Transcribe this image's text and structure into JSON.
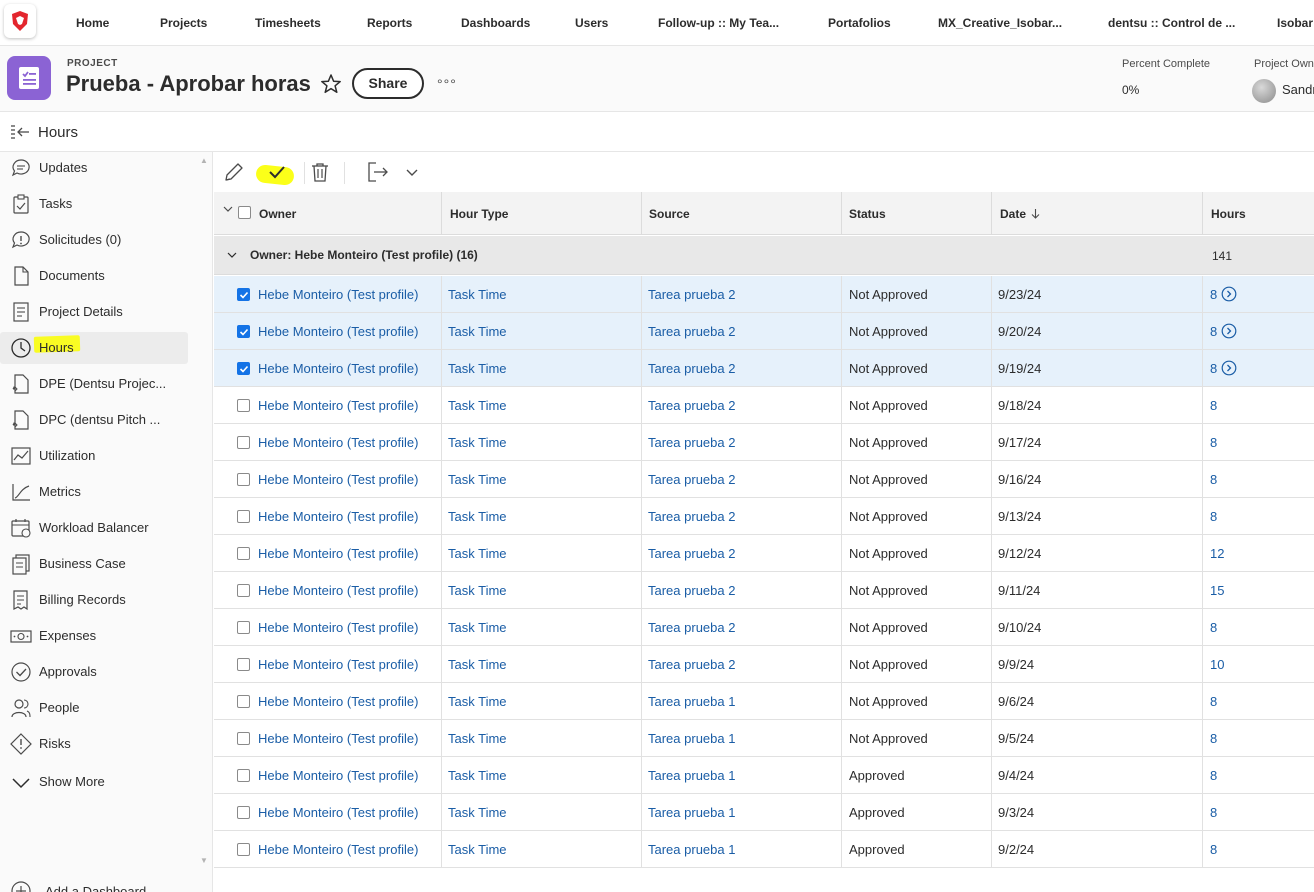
{
  "nav": {
    "items": [
      "Home",
      "Projects",
      "Timesheets",
      "Reports",
      "Dashboards",
      "Users",
      "Follow-up :: My Tea...",
      "Portafolios",
      "MX_Creative_Isobar...",
      "dentsu :: Control de ...",
      "Isobar -"
    ]
  },
  "project": {
    "label": "PROJECT",
    "title": "Prueba - Aprobar horas",
    "share": "Share",
    "more": "°°°",
    "percent_complete_label": "Percent Complete",
    "percent_complete_value": "0%",
    "owner_label": "Project Own",
    "owner_name": "Sandr"
  },
  "page": {
    "title": "Hours"
  },
  "sidebar": {
    "items": [
      {
        "label": "Updates",
        "icon": "updates-icon"
      },
      {
        "label": "Tasks",
        "icon": "tasks-icon"
      },
      {
        "label": "Solicitudes (0)",
        "icon": "issues-icon"
      },
      {
        "label": "Documents",
        "icon": "documents-icon"
      },
      {
        "label": "Project Details",
        "icon": "details-icon"
      },
      {
        "label": "Hours",
        "icon": "clock-icon"
      },
      {
        "label": "DPE (Dentsu Projec...",
        "icon": "custom-form-icon"
      },
      {
        "label": "DPC (dentsu Pitch ...",
        "icon": "custom-form-icon"
      },
      {
        "label": "Utilization",
        "icon": "utilization-icon"
      },
      {
        "label": "Metrics",
        "icon": "metrics-icon"
      },
      {
        "label": "Workload Balancer",
        "icon": "calendar-icon"
      },
      {
        "label": "Business Case",
        "icon": "business-case-icon"
      },
      {
        "label": "Billing Records",
        "icon": "billing-icon"
      },
      {
        "label": "Expenses",
        "icon": "expenses-icon"
      },
      {
        "label": "Approvals",
        "icon": "approvals-icon"
      },
      {
        "label": "People",
        "icon": "people-icon"
      },
      {
        "label": "Risks",
        "icon": "risks-icon"
      },
      {
        "label": "Show More",
        "icon": "chevron-down-icon"
      }
    ],
    "add_dashboard": "Add a Dashboard"
  },
  "table": {
    "columns": [
      "Owner",
      "Hour Type",
      "Source",
      "Status",
      "Date",
      "Hours"
    ],
    "group_label": "Owner: Hebe Monteiro (Test profile) (16)",
    "group_total": "141",
    "rows": [
      {
        "owner": "Hebe Monteiro (Test profile)",
        "hour_type": "Task Time",
        "source": "Tarea prueba 2",
        "status": "Not Approved",
        "date": "9/23/24",
        "hours": "8",
        "selected": true
      },
      {
        "owner": "Hebe Monteiro (Test profile)",
        "hour_type": "Task Time",
        "source": "Tarea prueba 2",
        "status": "Not Approved",
        "date": "9/20/24",
        "hours": "8",
        "selected": true
      },
      {
        "owner": "Hebe Monteiro (Test profile)",
        "hour_type": "Task Time",
        "source": "Tarea prueba 2",
        "status": "Not Approved",
        "date": "9/19/24",
        "hours": "8",
        "selected": true
      },
      {
        "owner": "Hebe Monteiro (Test profile)",
        "hour_type": "Task Time",
        "source": "Tarea prueba 2",
        "status": "Not Approved",
        "date": "9/18/24",
        "hours": "8",
        "selected": false
      },
      {
        "owner": "Hebe Monteiro (Test profile)",
        "hour_type": "Task Time",
        "source": "Tarea prueba 2",
        "status": "Not Approved",
        "date": "9/17/24",
        "hours": "8",
        "selected": false
      },
      {
        "owner": "Hebe Monteiro (Test profile)",
        "hour_type": "Task Time",
        "source": "Tarea prueba 2",
        "status": "Not Approved",
        "date": "9/16/24",
        "hours": "8",
        "selected": false
      },
      {
        "owner": "Hebe Monteiro (Test profile)",
        "hour_type": "Task Time",
        "source": "Tarea prueba 2",
        "status": "Not Approved",
        "date": "9/13/24",
        "hours": "8",
        "selected": false
      },
      {
        "owner": "Hebe Monteiro (Test profile)",
        "hour_type": "Task Time",
        "source": "Tarea prueba 2",
        "status": "Not Approved",
        "date": "9/12/24",
        "hours": "12",
        "selected": false
      },
      {
        "owner": "Hebe Monteiro (Test profile)",
        "hour_type": "Task Time",
        "source": "Tarea prueba 2",
        "status": "Not Approved",
        "date": "9/11/24",
        "hours": "15",
        "selected": false
      },
      {
        "owner": "Hebe Monteiro (Test profile)",
        "hour_type": "Task Time",
        "source": "Tarea prueba 2",
        "status": "Not Approved",
        "date": "9/10/24",
        "hours": "8",
        "selected": false
      },
      {
        "owner": "Hebe Monteiro (Test profile)",
        "hour_type": "Task Time",
        "source": "Tarea prueba 2",
        "status": "Not Approved",
        "date": "9/9/24",
        "hours": "10",
        "selected": false
      },
      {
        "owner": "Hebe Monteiro (Test profile)",
        "hour_type": "Task Time",
        "source": "Tarea prueba 1",
        "status": "Not Approved",
        "date": "9/6/24",
        "hours": "8",
        "selected": false
      },
      {
        "owner": "Hebe Monteiro (Test profile)",
        "hour_type": "Task Time",
        "source": "Tarea prueba 1",
        "status": "Not Approved",
        "date": "9/5/24",
        "hours": "8",
        "selected": false
      },
      {
        "owner": "Hebe Monteiro (Test profile)",
        "hour_type": "Task Time",
        "source": "Tarea prueba 1",
        "status": "Approved",
        "date": "9/4/24",
        "hours": "8",
        "selected": false
      },
      {
        "owner": "Hebe Monteiro (Test profile)",
        "hour_type": "Task Time",
        "source": "Tarea prueba 1",
        "status": "Approved",
        "date": "9/3/24",
        "hours": "8",
        "selected": false
      },
      {
        "owner": "Hebe Monteiro (Test profile)",
        "hour_type": "Task Time",
        "source": "Tarea prueba 1",
        "status": "Approved",
        "date": "9/2/24",
        "hours": "8",
        "selected": false
      }
    ]
  },
  "colors": {
    "link": "#1a5da6",
    "selected_row": "#e6f1fb",
    "checkbox_on": "#1473e6",
    "highlight": "#fbff00",
    "project_icon": "#8b63d4",
    "logo": "#e3262e"
  }
}
